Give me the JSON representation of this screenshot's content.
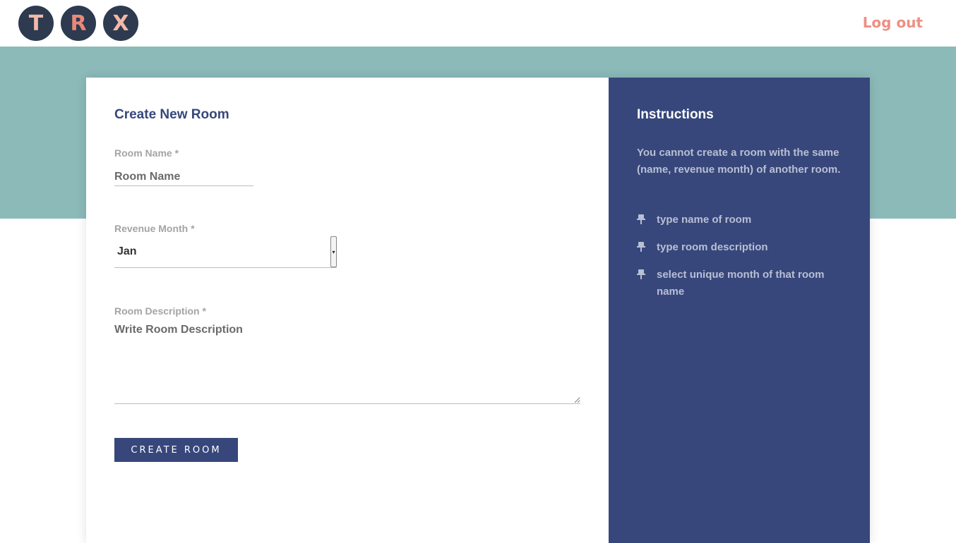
{
  "header": {
    "logo_letters": [
      "T",
      "R",
      "X"
    ],
    "logout_label": "Log out"
  },
  "form": {
    "title": "Create New Room",
    "room_name_label": "Room Name *",
    "room_name_placeholder": "Room Name",
    "revenue_month_label": "Revenue Month *",
    "revenue_month_value": "Jan",
    "description_label": "Room Description *",
    "description_placeholder": "Write Room Description",
    "create_label": "CREATE ROOM"
  },
  "instructions": {
    "title": "Instructions",
    "note": "You cannot create a room with the same (name, revenue month) of another room.",
    "steps": [
      "type name of room",
      "type room description",
      "select unique month of that room name"
    ],
    "step_icon": "pin-icon"
  },
  "colors": {
    "navy": "#37477b",
    "teal_band": "#8bbab9",
    "logout": "#ef8f84",
    "logo_circle": "#2d3a4f"
  }
}
